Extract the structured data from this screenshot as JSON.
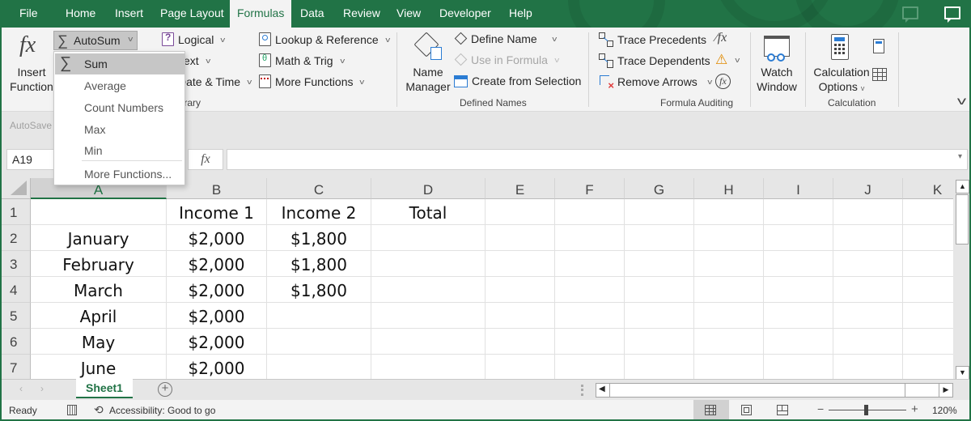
{
  "tabs": [
    {
      "label": "File"
    },
    {
      "label": "Home"
    },
    {
      "label": "Insert"
    },
    {
      "label": "Page Layout"
    },
    {
      "label": "Formulas",
      "active": true
    },
    {
      "label": "Data"
    },
    {
      "label": "Review"
    },
    {
      "label": "View"
    },
    {
      "label": "Developer"
    },
    {
      "label": "Help"
    }
  ],
  "ribbon": {
    "function_library": {
      "insert_function": {
        "line1": "Insert",
        "line2": "Function"
      },
      "autosum": "AutoSum",
      "logical": "Logical",
      "text": "Text",
      "date_time": "Date & Time",
      "lookup_reference": "Lookup & Reference",
      "math_trig": "Math & Trig",
      "more_functions": "More Functions",
      "group_label": "Function Library"
    },
    "defined_names": {
      "name_manager": {
        "line1": "Name",
        "line2": "Manager"
      },
      "define_name": "Define Name",
      "use_in_formula": "Use in Formula",
      "create_from_selection": "Create from Selection",
      "group_label": "Defined Names"
    },
    "formula_auditing": {
      "trace_precedents": "Trace Precedents",
      "trace_dependents": "Trace Dependents",
      "remove_arrows": "Remove Arrows",
      "watch_window": {
        "line1": "Watch",
        "line2": "Window"
      },
      "group_label": "Formula Auditing"
    },
    "calculation": {
      "calculation_options": {
        "line1": "Calculation",
        "line2": "Options"
      },
      "group_label": "Calculation"
    }
  },
  "autosum_menu": {
    "items": [
      {
        "label": "Sum",
        "hovered": true
      },
      {
        "label": "Average"
      },
      {
        "label": "Count Numbers"
      },
      {
        "label": "Max"
      },
      {
        "label": "Min"
      },
      {
        "label": "More Functions..."
      }
    ]
  },
  "quick_access": {
    "autosave": "AutoSave"
  },
  "formula_bar": {
    "name_box": "A19",
    "fx": "fx",
    "formula": ""
  },
  "sheet": {
    "columns": [
      "A",
      "B",
      "C",
      "D",
      "E",
      "F",
      "G",
      "H",
      "I",
      "J",
      "K"
    ],
    "selected_column": "A",
    "rows": [
      {
        "num": "1",
        "cells": [
          "",
          "Income 1",
          "Income 2",
          "Total",
          "",
          "",
          "",
          "",
          "",
          "",
          ""
        ]
      },
      {
        "num": "2",
        "cells": [
          "January",
          "$2,000",
          "$1,800",
          "",
          "",
          "",
          "",
          "",
          "",
          "",
          ""
        ]
      },
      {
        "num": "3",
        "cells": [
          "February",
          "$2,000",
          "$1,800",
          "",
          "",
          "",
          "",
          "",
          "",
          "",
          ""
        ]
      },
      {
        "num": "4",
        "cells": [
          "March",
          "$2,000",
          "$1,800",
          "",
          "",
          "",
          "",
          "",
          "",
          "",
          ""
        ]
      },
      {
        "num": "5",
        "cells": [
          "April",
          "$2,000",
          "",
          "",
          "",
          "",
          "",
          "",
          "",
          "",
          ""
        ]
      },
      {
        "num": "6",
        "cells": [
          "May",
          "$2,000",
          "",
          "",
          "",
          "",
          "",
          "",
          "",
          "",
          ""
        ]
      },
      {
        "num": "7",
        "cells": [
          "June",
          "$2,000",
          "",
          "",
          "",
          "",
          "",
          "",
          "",
          "",
          ""
        ]
      }
    ]
  },
  "sheet_tabs": [
    {
      "label": "Sheet1",
      "active": true
    }
  ],
  "status_bar": {
    "ready": "Ready",
    "accessibility": "Accessibility: Good to go",
    "zoom": "120%",
    "zoom_minus": "−",
    "zoom_plus": "+"
  }
}
